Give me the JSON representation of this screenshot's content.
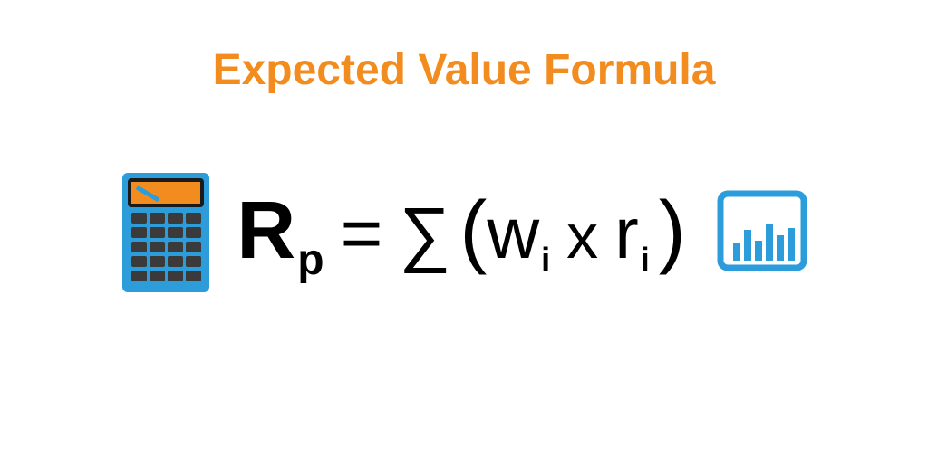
{
  "title": "Expected Value Formula",
  "formula": {
    "lhs_var": "R",
    "lhs_sub": "p",
    "eq": "=",
    "sigma": "∑",
    "lparen": "(",
    "term1_var": "w",
    "term1_sub": "i",
    "times": "x",
    "term2_var": "r",
    "term2_sub": "i",
    "rparen": ")"
  },
  "colors": {
    "title": "#f28c1e",
    "formula": "#000000",
    "icon_blue": "#2d9cdb",
    "icon_dark": "#3a3a3a",
    "icon_orange": "#f28c1e"
  }
}
